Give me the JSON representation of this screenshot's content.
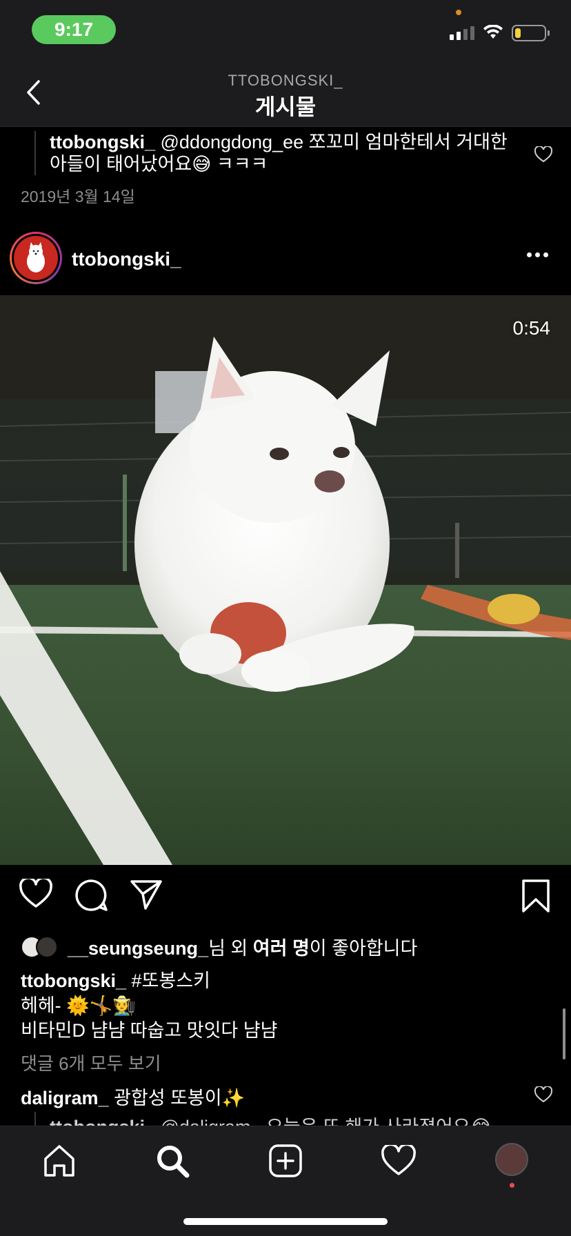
{
  "status_bar": {
    "time": "9:17",
    "battery_level": 0.2,
    "battery_color": "#f0d23a",
    "time_pill_color": "#5ac95e"
  },
  "header": {
    "username_caps": "TTOBONGSKI_",
    "title": "게시물",
    "back_icon": "chevron-left-icon"
  },
  "previous_reply": {
    "username": "ttobongski_",
    "text": "@ddongdong_ee 쪼꼬미 엄마한테서 거대한 아들이 태어났어요😅 ㅋㅋㅋ"
  },
  "previous_post_date": "2019년 3월 14일",
  "post": {
    "username": "ttobongski_",
    "video_duration": "0:54",
    "liked_by_user": "__seungseung_",
    "liked_by_suffix": "님 외 ",
    "liked_by_others": "여러 명",
    "liked_by_end": "이 좋아합니다",
    "caption_username": "ttobongski_",
    "caption_line1": " #또봉스키",
    "caption_line2": "헤헤- 🌞🤸🧑‍🌾",
    "caption_line3": "비타민D 냠냠 따숩고 맛잇다 냠냠",
    "view_comments": "댓글 6개 모두 보기"
  },
  "comment": {
    "username": "daligram_",
    "text": " 광합성 또봉이✨"
  },
  "comment_reply": {
    "username": "ttobongski_",
    "text": " @daligram_ 오늘은 또 해가 사라졌어요😂"
  },
  "tabs": [
    "home-icon",
    "search-icon",
    "add-post-icon",
    "activity-heart-icon",
    "profile-avatar"
  ],
  "colors": {
    "background": "#000000",
    "bar": "#1c1c1e",
    "muted": "#8e8e8e",
    "notification": "#ed4956"
  }
}
